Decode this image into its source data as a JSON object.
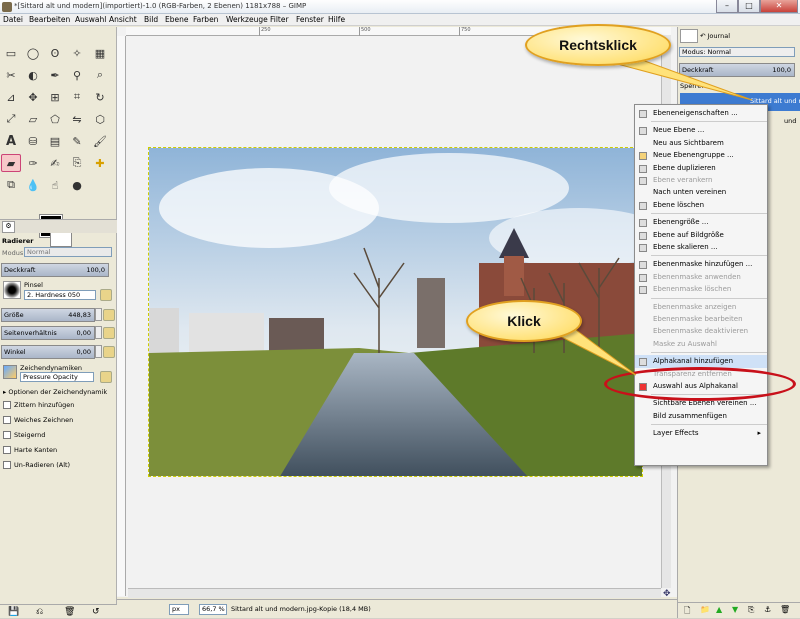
{
  "window": {
    "title": "*[Sittard alt und modern](importiert)-1.0 (RGB-Farben, 2 Ebenen) 1181x788 – GIMP",
    "min": "–",
    "max": "□",
    "close": "✕"
  },
  "menubar": [
    "Datei",
    "Bearbeiten",
    "Auswahl",
    "Ansicht",
    "Bild",
    "Ebene",
    "Farben",
    "Werkzeuge",
    "Filter",
    "Fenster",
    "Hilfe"
  ],
  "tool_options": {
    "title": "Radierer",
    "mode_label": "Modus",
    "mode_value": "Normal",
    "opacity_label": "Deckkraft",
    "opacity_value": "100,0",
    "brush_label": "Pinsel",
    "brush_value": "2. Hardness 050",
    "size_label": "Größe",
    "size_value": "448,83",
    "aspect_label": "Seitenverhältnis",
    "aspect_value": "0,00",
    "angle_label": "Winkel",
    "angle_value": "0,00",
    "dynamics_label": "Zeichendynamiken",
    "dynamics_value": "Pressure Opacity",
    "options": [
      "Optionen der Zeichendynamik",
      "Zittern hinzufügen",
      "Weiches Zeichnen",
      "Steigernd",
      "Harte Kanten",
      "Un-Radieren (Alt)"
    ]
  },
  "ruler_ticks": [
    "250",
    "500",
    "750",
    "1000"
  ],
  "statusbar": {
    "unit": "px",
    "zoom": "66,7 %",
    "info": "Sittard alt und modern.jpg-Kopie (18,4 MB)"
  },
  "dock": {
    "tab_label": "Journal",
    "mode_label": "Modus: Normal",
    "opacity_label": "Deckkraft",
    "opacity_value": "100,0",
    "lock_label": "Sperre:",
    "layer1": "Sittard alt und m",
    "layer2": "und"
  },
  "context_menu": [
    {
      "label": "Ebeneneigenschaften ...",
      "icon": "layer-properties-icon",
      "disabled": false
    },
    {
      "sep": true
    },
    {
      "label": "Neue Ebene ...",
      "icon": "new-layer-icon",
      "disabled": false
    },
    {
      "label": "Neu aus Sichtbarem",
      "icon": "",
      "disabled": false
    },
    {
      "label": "Neue Ebenengruppe ...",
      "icon": "folder-icon",
      "disabled": false
    },
    {
      "label": "Ebene duplizieren",
      "icon": "duplicate-icon",
      "disabled": false
    },
    {
      "label": "Ebene verankern",
      "icon": "anchor-icon",
      "disabled": true
    },
    {
      "label": "Nach unten vereinen",
      "icon": "",
      "disabled": false
    },
    {
      "label": "Ebene löschen",
      "icon": "delete-icon",
      "disabled": false
    },
    {
      "sep": true
    },
    {
      "label": "Ebenengröße ...",
      "icon": "resize-icon",
      "disabled": false
    },
    {
      "label": "Ebene auf Bildgröße",
      "icon": "fit-icon",
      "disabled": false
    },
    {
      "label": "Ebene skalieren ...",
      "icon": "scale-icon",
      "disabled": false
    },
    {
      "sep": true
    },
    {
      "label": "Ebenenmaske hinzufügen ...",
      "icon": "mask-add-icon",
      "disabled": false
    },
    {
      "label": "Ebenenmaske anwenden",
      "icon": "mask-apply-icon",
      "disabled": true
    },
    {
      "label": "Ebenenmaske löschen",
      "icon": "mask-delete-icon",
      "disabled": true
    },
    {
      "sep": true
    },
    {
      "label": "Ebenenmaske anzeigen",
      "icon": "",
      "disabled": true
    },
    {
      "label": "Ebenenmaske bearbeiten",
      "icon": "",
      "disabled": true
    },
    {
      "label": "Ebenenmaske deaktivieren",
      "icon": "",
      "disabled": true
    },
    {
      "label": "Maske zu Auswahl",
      "icon": "",
      "disabled": true
    },
    {
      "sep": true
    },
    {
      "label": "Alphakanal hinzufügen",
      "icon": "alpha-icon",
      "disabled": false,
      "highlight": true
    },
    {
      "label": "Transparenz entfernen",
      "icon": "",
      "disabled": true
    },
    {
      "label": "Auswahl aus Alphakanal",
      "icon": "alpha-select-icon",
      "disabled": false
    },
    {
      "sep": true
    },
    {
      "label": "Sichtbare Ebenen vereinen ...",
      "icon": "",
      "disabled": false
    },
    {
      "label": "Bild zusammenfügen",
      "icon": "",
      "disabled": false
    },
    {
      "sep": true
    },
    {
      "label": "Layer Effects",
      "icon": "",
      "disabled": false,
      "submenu": true
    }
  ],
  "callouts": {
    "right_click": "Rechtsklick",
    "click": "Klick"
  },
  "colors": {
    "highlight_ring": "#c8101a",
    "callout": "#ffe27a"
  }
}
